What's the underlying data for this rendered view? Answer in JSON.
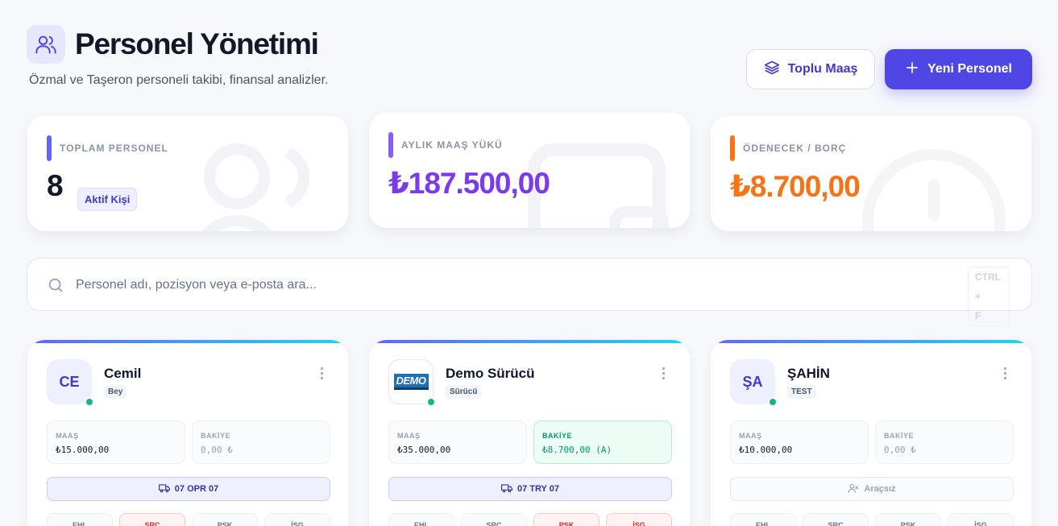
{
  "header": {
    "title": "Personel Yönetimi",
    "subtitle": "Özmal ve Taşeron personeli takibi, finansal analizler.",
    "bulk_salary_label": "Toplu Maaş",
    "new_personnel_label": "Yeni Personel"
  },
  "stats": [
    {
      "label": "TOPLAM PERSONEL",
      "value": "8",
      "badge": "Aktif Kişi",
      "accent": "#6366f1",
      "value_color": "#111827"
    },
    {
      "label": "AYLIK MAAŞ YÜKÜ",
      "value": "₺187.500,00",
      "accent": "#8b5cf6",
      "value_color": "#7c3aed"
    },
    {
      "label": "ÖDENECEK / BORÇ",
      "value": "₺8.700,00",
      "accent": "#f97316",
      "value_color": "#f97316"
    }
  ],
  "search": {
    "placeholder": "Personel adı, pozisyon veya e-posta ara...",
    "shortcut_line1": "CTRL +",
    "shortcut_line2": "F"
  },
  "personnel": [
    {
      "initials": "CE",
      "name": "Cemil",
      "role": "Bey",
      "salary_label": "MAAŞ",
      "salary": "₺15.000,00",
      "balance_label": "BAKİYE",
      "balance": "0,00 ₺",
      "vehicle": "07 OPR 07",
      "docs": [
        "EHL",
        "SRC",
        "PSK",
        "İSG"
      ]
    },
    {
      "logo_text": "DEMO",
      "name": "Demo Sürücü",
      "role": "Sürücü",
      "salary_label": "MAAŞ",
      "salary": "₺35.000,00",
      "balance_label": "BAKİYE",
      "balance": "₺8.700,00 (A)",
      "vehicle": "07 TRY 07",
      "docs": [
        "EHL",
        "SRC",
        "PSK",
        "İSG"
      ]
    },
    {
      "initials": "ŞA",
      "name": "ŞAHİN",
      "role": "TEST",
      "salary_label": "MAAŞ",
      "salary": "₺10.000,00",
      "balance_label": "BAKİYE",
      "balance": "0,00 ₺",
      "vehicle": "Araçsız",
      "docs": [
        "EHL",
        "SRC",
        "PSK",
        "İSG"
      ]
    }
  ],
  "icons": {
    "header": "users-icon",
    "bulk_salary": "layers-icon",
    "new_personnel": "plus-icon",
    "search": "search-icon",
    "vehicle": "truck-icon",
    "no_vehicle": "user-x-icon",
    "menu": "more-vertical-icon"
  },
  "colors": {
    "primary": "#4f46e5",
    "success": "#10b981",
    "warning": "#f97316",
    "danger": "#dc2626"
  }
}
